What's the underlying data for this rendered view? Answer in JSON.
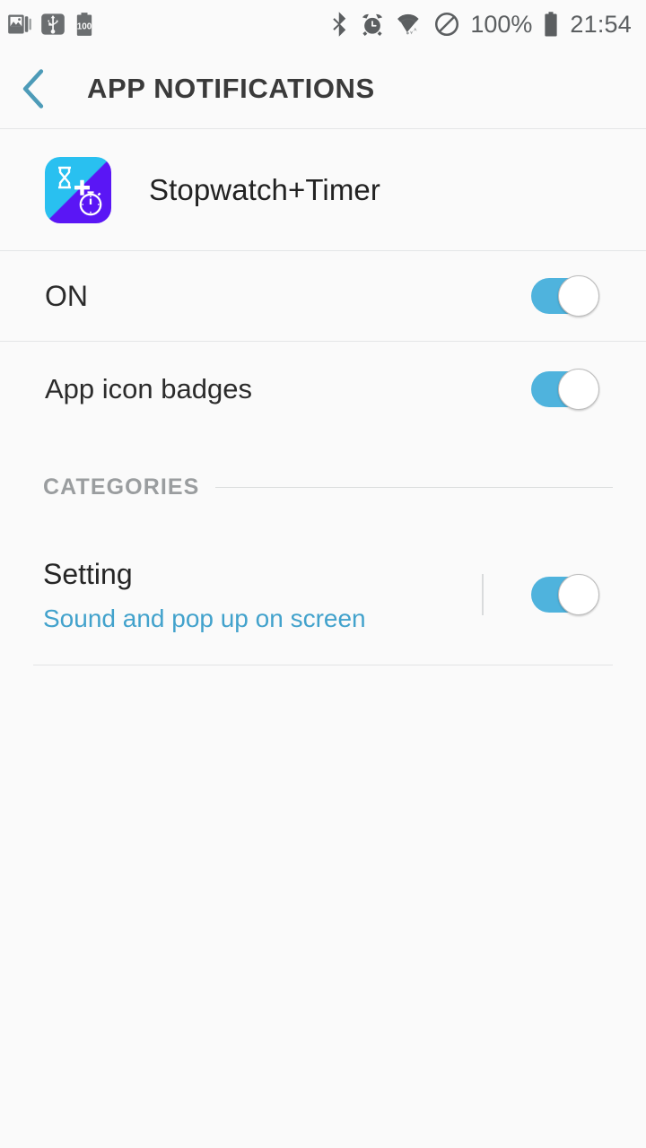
{
  "status_bar": {
    "notification_icons": [
      {
        "name": "screenshot-icon",
        "label": "Screenshot"
      },
      {
        "name": "usb-icon",
        "label": "USB connected"
      },
      {
        "name": "battery-notification-icon",
        "label": "100"
      }
    ],
    "battery_notification_text": "100",
    "system_icons": [
      {
        "name": "bluetooth-icon",
        "label": "Bluetooth"
      },
      {
        "name": "alarm-icon",
        "label": "Alarm"
      },
      {
        "name": "wifi-icon",
        "label": "Wi-Fi"
      },
      {
        "name": "do-not-disturb-icon",
        "label": "Do not disturb"
      }
    ],
    "battery_percent": "100%",
    "clock": "21:54"
  },
  "header": {
    "back_label": "Back",
    "title": "APP NOTIFICATIONS"
  },
  "app": {
    "name": "Stopwatch+Timer",
    "icon_name": "stopwatch-timer-app-icon"
  },
  "settings": {
    "master_toggle": {
      "label": "ON",
      "state": "on"
    },
    "badges_toggle": {
      "label": "App icon badges",
      "state": "on"
    }
  },
  "categories": {
    "section_label": "CATEGORIES",
    "items": [
      {
        "title": "Setting",
        "subtitle": "Sound and pop up on screen",
        "state": "on"
      }
    ]
  },
  "colors": {
    "accent": "#4fb3dd",
    "subtitle_blue": "#42a2cc",
    "background": "#fafafa",
    "title_text": "#3a3a3a",
    "section_header": "#9a9d9f",
    "app_icon_cyan": "#29c0f0",
    "app_icon_purple": "#5a16f5"
  }
}
